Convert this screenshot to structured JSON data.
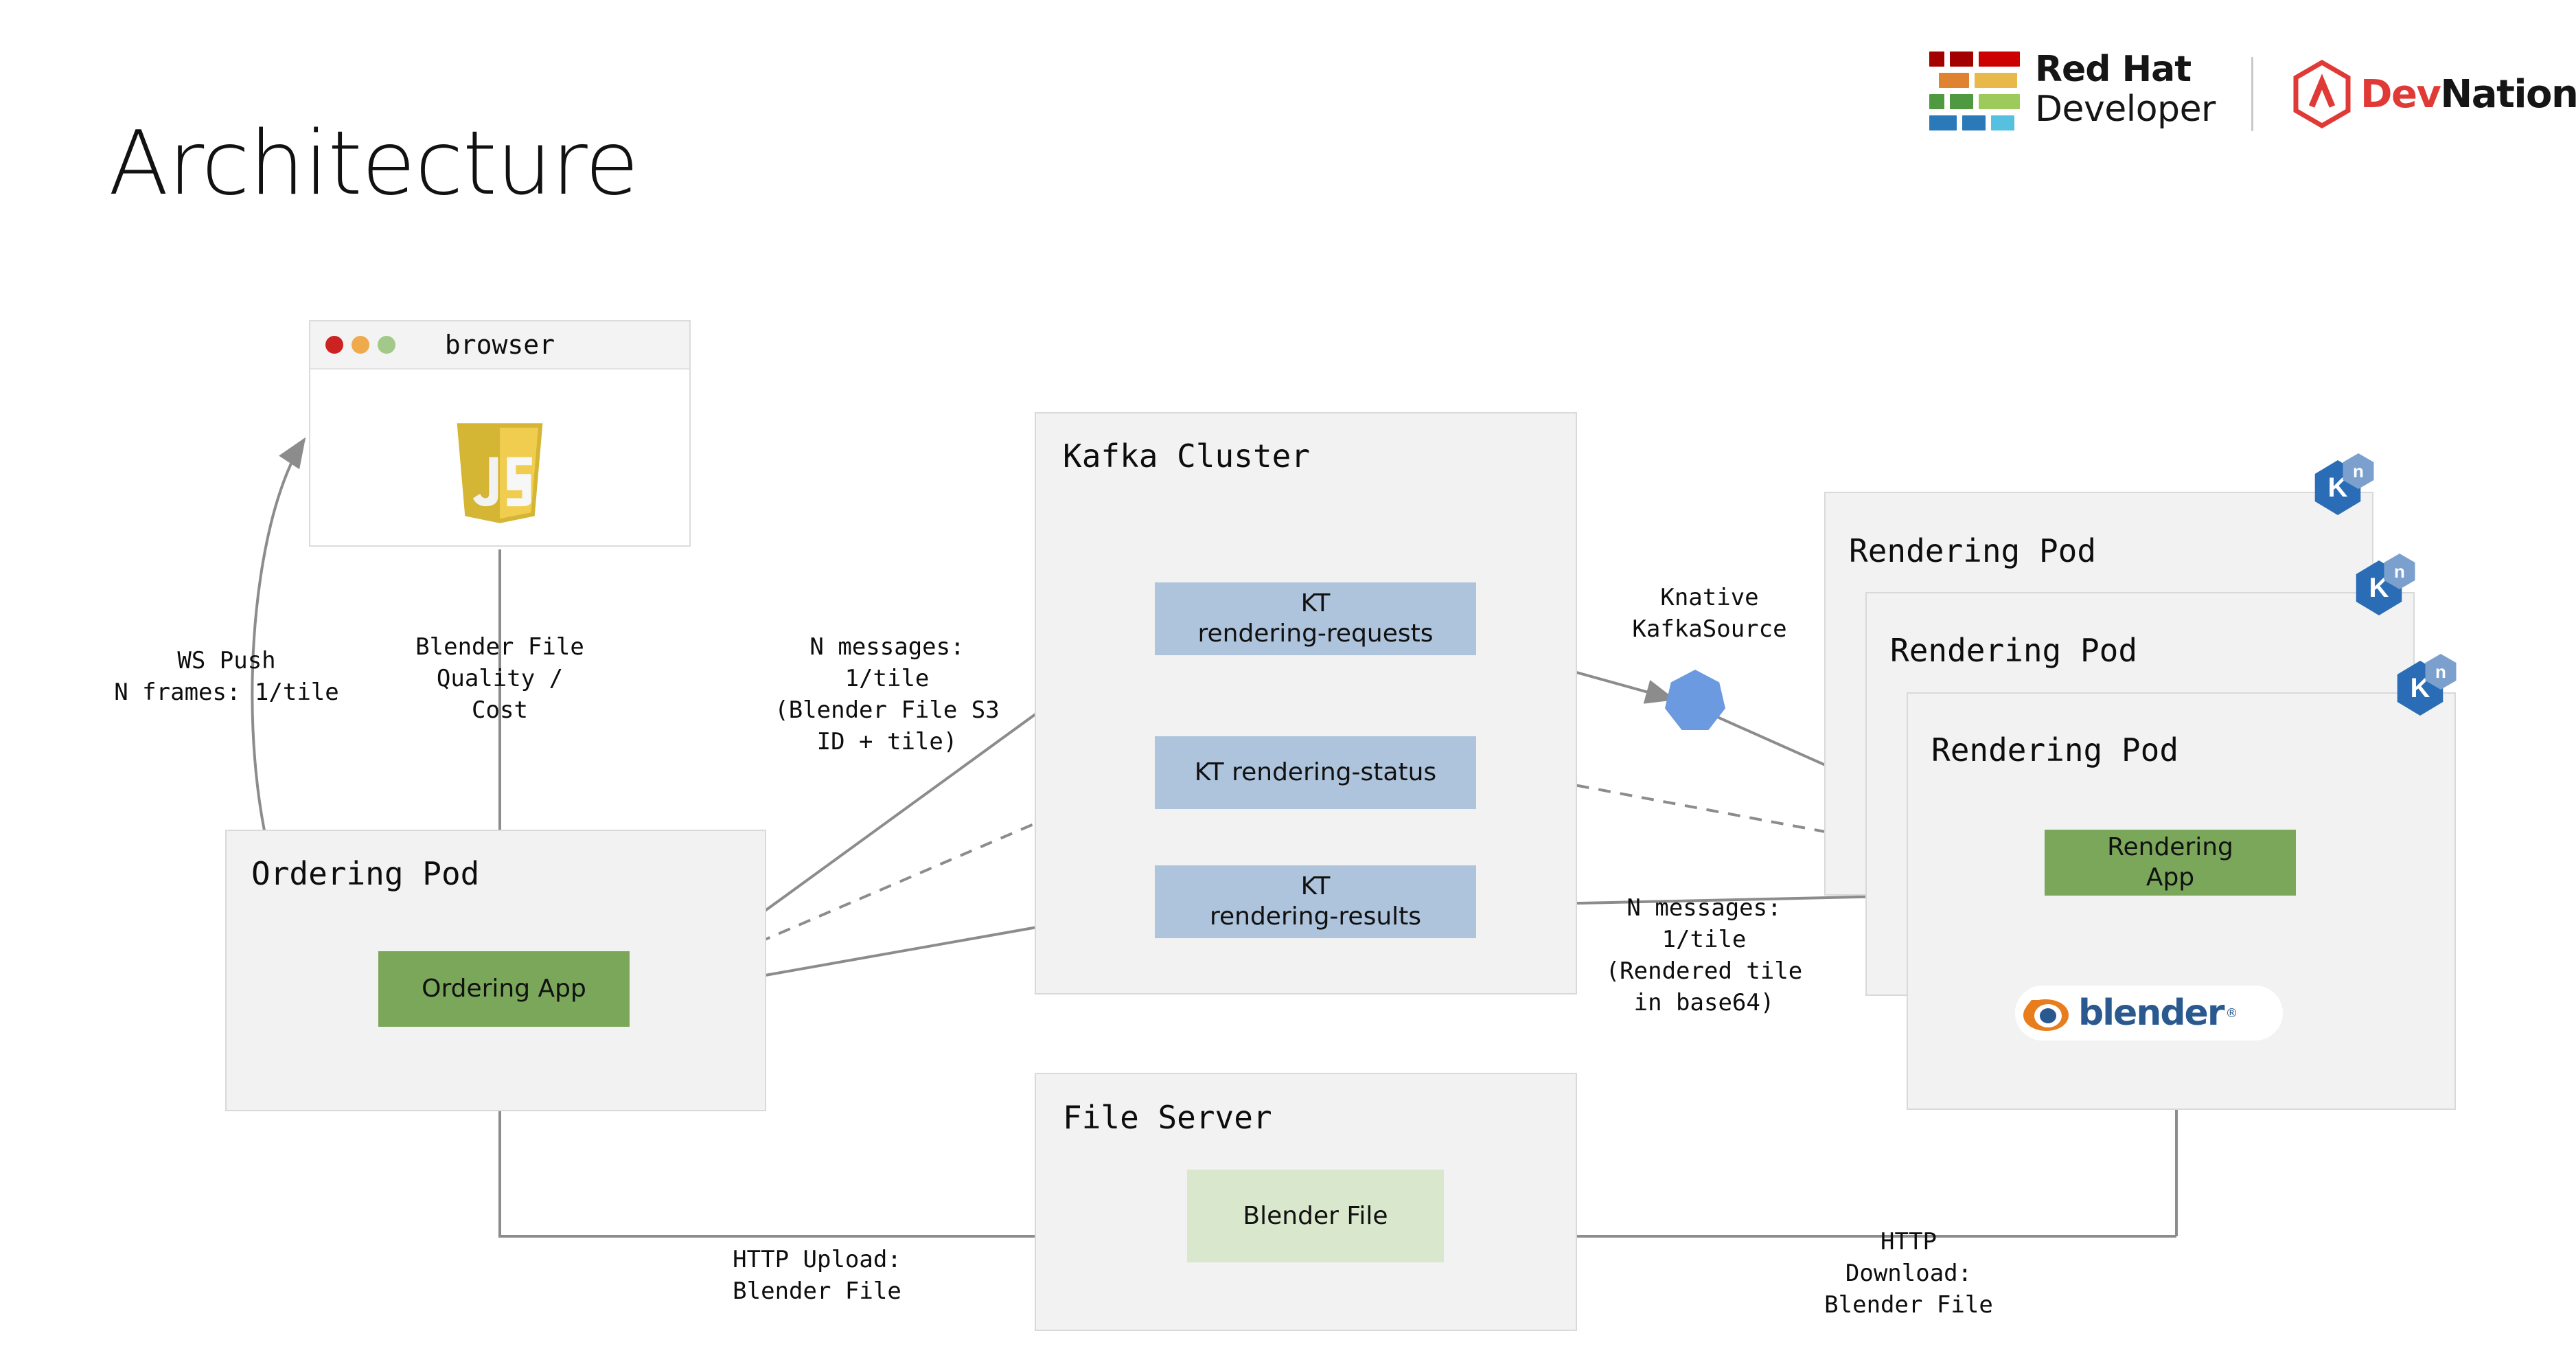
{
  "page": {
    "title": "Architecture"
  },
  "brand": {
    "redhat_line1": "Red Hat",
    "redhat_line2": "Developer",
    "devnation_dev": "Dev",
    "devnation_nation": "Nation",
    "colors": {
      "redhat_red": "#cc0000",
      "devnation_red": "#e03a36",
      "hat_dark_red": "#a30000",
      "hat_orange": "#e08330",
      "hat_yellow": "#e8b94a",
      "hat_green_dark": "#4f9a41",
      "hat_green_light": "#9ccb5b",
      "hat_blue_dark": "#2a7ab9",
      "hat_blue_light": "#56c0e0"
    }
  },
  "browser": {
    "title": "browser",
    "dots": [
      "#cc2222",
      "#eeaa4d",
      "#a2c98a"
    ],
    "content_icon": "javascript-logo"
  },
  "groups": [
    {
      "key": "ordering_pod",
      "title": "Ordering Pod"
    },
    {
      "key": "kafka_cluster",
      "title": "Kafka Cluster"
    },
    {
      "key": "file_server",
      "title": "File Server"
    },
    {
      "key": "rendering_pod_back",
      "title": "Rendering Pod"
    },
    {
      "key": "rendering_pod_middle",
      "title": "Rendering Pod"
    },
    {
      "key": "rendering_pod_front",
      "title": "Rendering Pod"
    }
  ],
  "nodes": {
    "ordering_app": {
      "label": "Ordering App",
      "color": "#7ba75a"
    },
    "kafka_topic_requests": {
      "label": "KT\nrendering-requests",
      "color": "#aec4dc"
    },
    "kafka_topic_status": {
      "label": "KT rendering-status",
      "color": "#aec4dc"
    },
    "kafka_topic_results": {
      "label": "KT\nrendering-results",
      "color": "#aec4dc"
    },
    "blender_file": {
      "label": "Blender File",
      "color": "#d9e8cc"
    },
    "rendering_app": {
      "label": "Rendering\nApp",
      "color": "#7ba75a"
    },
    "knative_kafkasource_shape": {
      "label": "",
      "color": "#6b9ae0"
    },
    "blender_logo": {
      "label": "blender",
      "registered": "®"
    }
  },
  "badges": [
    {
      "main": "K",
      "sup": "n"
    },
    {
      "main": "K",
      "sup": "n"
    },
    {
      "main": "K",
      "sup": "n"
    }
  ],
  "edge_labels": {
    "ws_push": "WS Push\nN frames: 1/tile",
    "blender_file_quality_cost": "Blender File\nQuality /\nCost",
    "n_messages_requests": "N messages:\n1/tile\n(Blender File S3\nID + tile)",
    "knative_kafkasource": "Knative\nKafkaSource",
    "n_messages_results": "N messages:\n1/tile\n(Rendered tile\nin base64)",
    "http_upload": "HTTP Upload:\nBlender File",
    "http_download": "HTTP\nDownload:\nBlender File"
  },
  "palette": {
    "edge_stroke": "#8c8c8c",
    "group_fill": "#f2f2f2",
    "group_border": "#d9d9d9",
    "background": "#ffffff"
  }
}
